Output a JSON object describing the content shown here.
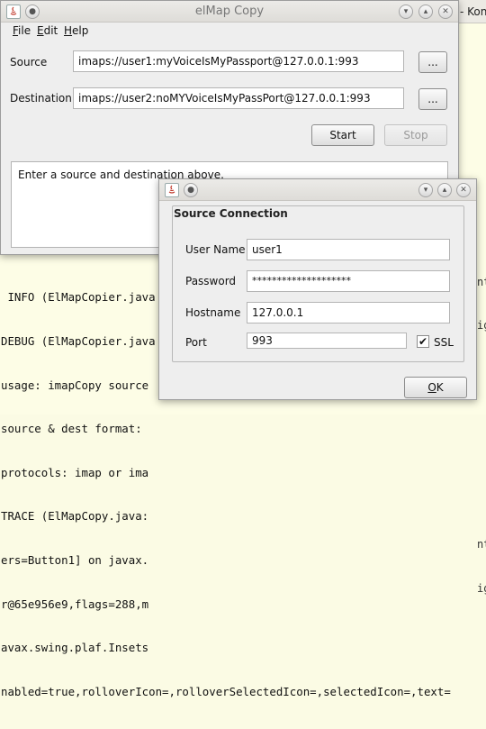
{
  "terminal": {
    "title": "- Kon",
    "lines": [
      " INFO (ElMapCopier.java",
      "DEBUG (ElMapCopier.java",
      "usage: imapCopy source",
      "source & dest format: ",
      "protocols: imap or ima",
      "TRACE (ElMapCopy.java:",
      "ers=Button1] on javax.",
      "r@65e956e9,flags=288,m",
      "avax.swing.plaf.Insets",
      "nabled=true,rolloverIcon=,rolloverSelectedIcon=,selectedIcon=,text="
    ],
    "side_chars": [
      "",
      "nt",
      "ig",
      "",
      "",
      "",
      "",
      "",
      "",
      "nt",
      "ig"
    ]
  },
  "main_window": {
    "title": "elMap Copy",
    "menu": [
      {
        "mnemonic": "F",
        "rest": "ile"
      },
      {
        "mnemonic": "E",
        "rest": "dit"
      },
      {
        "mnemonic": "H",
        "rest": "elp"
      }
    ],
    "source_label": "Source",
    "source_value": "imaps://user1:myVoiceIsMyPassport@127.0.0.1:993",
    "destination_label": "Destination",
    "destination_value": "imaps://user2:noMYVoiceIsMyPassPort@127.0.0.1:993",
    "browse_label": "...",
    "start_label": "Start",
    "stop_label": "Stop",
    "status_text": "Enter a source and destination above."
  },
  "dialog": {
    "group_title": "Source Connection",
    "username_label": "User Name",
    "username_value": "user1",
    "password_label": "Password",
    "password_value": "********************",
    "hostname_label": "Hostname",
    "hostname_value": "127.0.0.1",
    "port_label": "Port",
    "port_value": "993",
    "ssl_label": "SSL",
    "ssl_checked": true,
    "ok_mnemonic": "O",
    "ok_rest": "K"
  }
}
